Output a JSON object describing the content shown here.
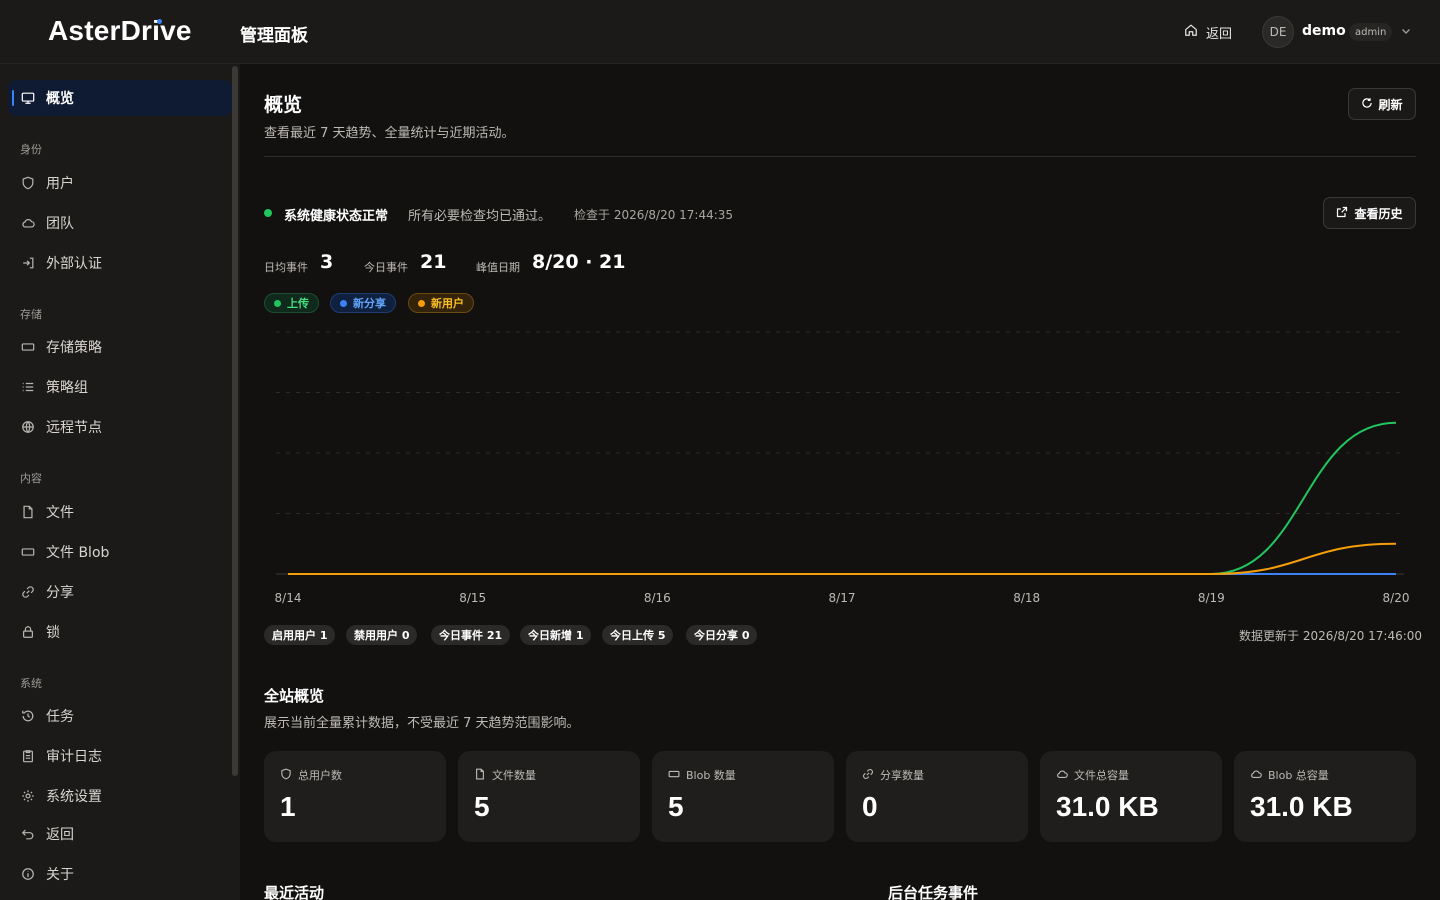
{
  "header": {
    "logo": "AsterDrive",
    "title": "管理面板",
    "back_label": "返回",
    "avatar_initials": "DE",
    "user_name": "demo",
    "user_role": "admin"
  },
  "sidebar": {
    "overview": "概览",
    "sections": [
      {
        "title": "身份",
        "items": [
          "用户",
          "团队",
          "外部认证"
        ]
      },
      {
        "title": "存储",
        "items": [
          "存储策略",
          "策略组",
          "远程节点"
        ]
      },
      {
        "title": "内容",
        "items": [
          "文件",
          "文件 Blob",
          "分享",
          "锁"
        ]
      },
      {
        "title": "系统",
        "items": [
          "任务",
          "审计日志",
          "系统设置",
          "返回",
          "关于"
        ]
      }
    ]
  },
  "main": {
    "title": "概览",
    "subtitle": "查看最近 7 天趋势、全量统计与近期活动。",
    "refresh_label": "刷新",
    "health": {
      "title": "系统健康状态正常",
      "message": "所有必要检查均已通过。",
      "checked_at": "检查于 2026/8/20 17:44:35",
      "history_label": "查看历史"
    },
    "kpis": {
      "avg_label": "日均事件",
      "avg_value": "3",
      "today_label": "今日事件",
      "today_value": "21",
      "peak_label": "峰值日期",
      "peak_value": "8/20 · 21"
    },
    "legend": [
      {
        "label": "上传",
        "color": "#22c55e"
      },
      {
        "label": "新分享",
        "color": "#3b82f6"
      },
      {
        "label": "新用户",
        "color": "#f59e0b"
      }
    ],
    "stat_pills": [
      "启用用户 1",
      "禁用用户 0",
      "今日事件 21",
      "今日新增 1",
      "今日上传 5",
      "今日分享 0"
    ],
    "updated_at": "数据更新于 2026/8/20 17:46:00",
    "totals_title": "全站概览",
    "totals_subtitle": "展示当前全量累计数据，不受最近 7 天趋势范围影响。",
    "cards": [
      {
        "label": "总用户数",
        "value": "1",
        "icon": "shield-icon"
      },
      {
        "label": "文件数量",
        "value": "5",
        "icon": "file-icon"
      },
      {
        "label": "Blob 数量",
        "value": "5",
        "icon": "blob-icon"
      },
      {
        "label": "分享数量",
        "value": "0",
        "icon": "link-icon"
      },
      {
        "label": "文件总容量",
        "value": "31.0 KB",
        "icon": "cloud-icon"
      },
      {
        "label": "Blob 总容量",
        "value": "31.0 KB",
        "icon": "cloud-icon"
      }
    ],
    "recent_title": "最近活动",
    "tasks_title": "后台任务事件"
  },
  "chart_data": {
    "type": "line",
    "categories": [
      "8/14",
      "8/15",
      "8/16",
      "8/17",
      "8/18",
      "8/19",
      "8/20"
    ],
    "series": [
      {
        "name": "上传",
        "color": "#22c55e",
        "values": [
          0,
          0,
          0,
          0,
          0,
          0,
          15
        ]
      },
      {
        "name": "新分享",
        "color": "#3b82f6",
        "values": [
          0,
          0,
          0,
          0,
          0,
          0,
          0
        ]
      },
      {
        "name": "新用户",
        "color": "#f59e0b",
        "values": [
          0,
          0,
          0,
          0,
          0,
          0,
          3
        ]
      }
    ],
    "ylim": [
      0,
      24
    ],
    "grid": true
  }
}
